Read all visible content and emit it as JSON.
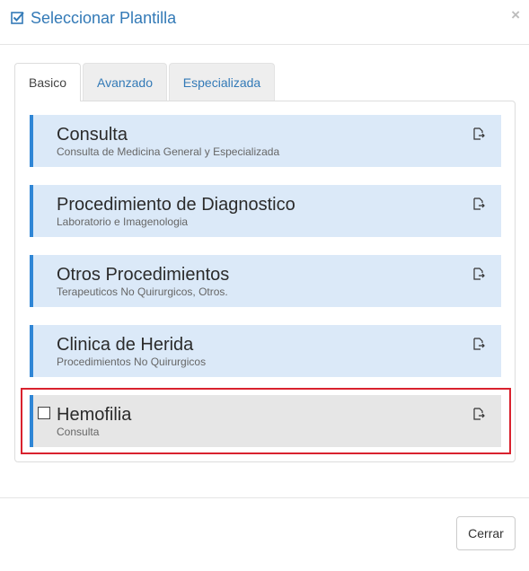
{
  "header": {
    "title": "Seleccionar Plantilla",
    "close_label": "×",
    "accent": "#337ab7"
  },
  "tabs": [
    {
      "label": "Basico",
      "active": true
    },
    {
      "label": "Avanzado",
      "active": false
    },
    {
      "label": "Especializada",
      "active": false
    }
  ],
  "templates": [
    {
      "title": "Consulta",
      "subtitle": "Consulta de Medicina General y Especializada",
      "selected": false
    },
    {
      "title": "Procedimiento de Diagnostico",
      "subtitle": "Laboratorio e Imagenologia",
      "selected": false
    },
    {
      "title": "Otros Procedimientos",
      "subtitle": "Terapeuticos No Quirurgicos, Otros.",
      "selected": false
    },
    {
      "title": "Clinica de Herida",
      "subtitle": "Procedimientos No Quirurgicos",
      "selected": false
    },
    {
      "title": "Hemofilia",
      "subtitle": "Consulta",
      "selected": true
    }
  ],
  "icons": {
    "title": "checkbox-checked-icon",
    "template_action": "document-export-icon",
    "selection": "checkbox-unchecked-icon"
  },
  "colors": {
    "card_bg": "#dbe9f8",
    "card_border": "#2f86d6",
    "selected_bg": "#e6e6e6",
    "highlight": "#d9222e"
  },
  "footer": {
    "close_button": "Cerrar"
  }
}
